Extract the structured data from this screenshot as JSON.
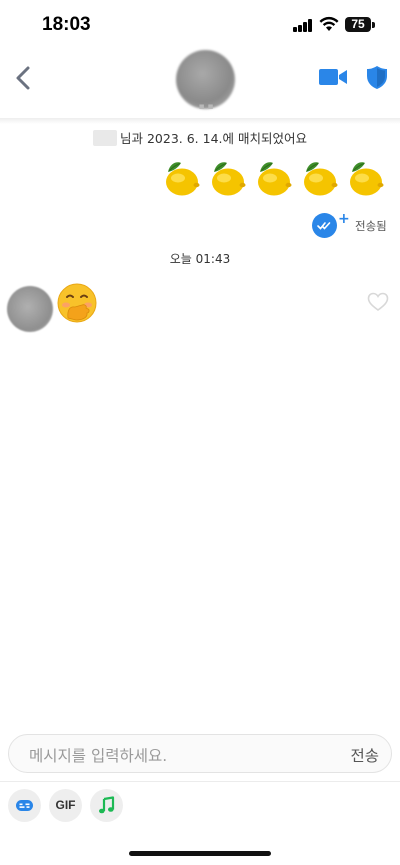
{
  "status_bar": {
    "time": "18:03",
    "battery": "75"
  },
  "header": {
    "back_icon": "chevron-left-icon",
    "video_icon": "video-camera-icon",
    "shield_icon": "shield-icon",
    "accent_color": "#2a86e8"
  },
  "chat": {
    "match_notice": "님과 2023. 6. 14.에 매치되었어요",
    "sent_message_emoji": [
      "🍋",
      "🍋",
      "🍋",
      "🍋",
      "🍋"
    ],
    "sent_status": "전송됨",
    "date_separator": "오늘 01:43",
    "received_message_emoji": "🤭"
  },
  "input": {
    "placeholder": "메시지를 입력하세요.",
    "send_label": "전송"
  },
  "toolbar": {
    "gif_label": "GIF",
    "items": [
      "sticker-icon",
      "gif-button",
      "music-icon"
    ]
  }
}
